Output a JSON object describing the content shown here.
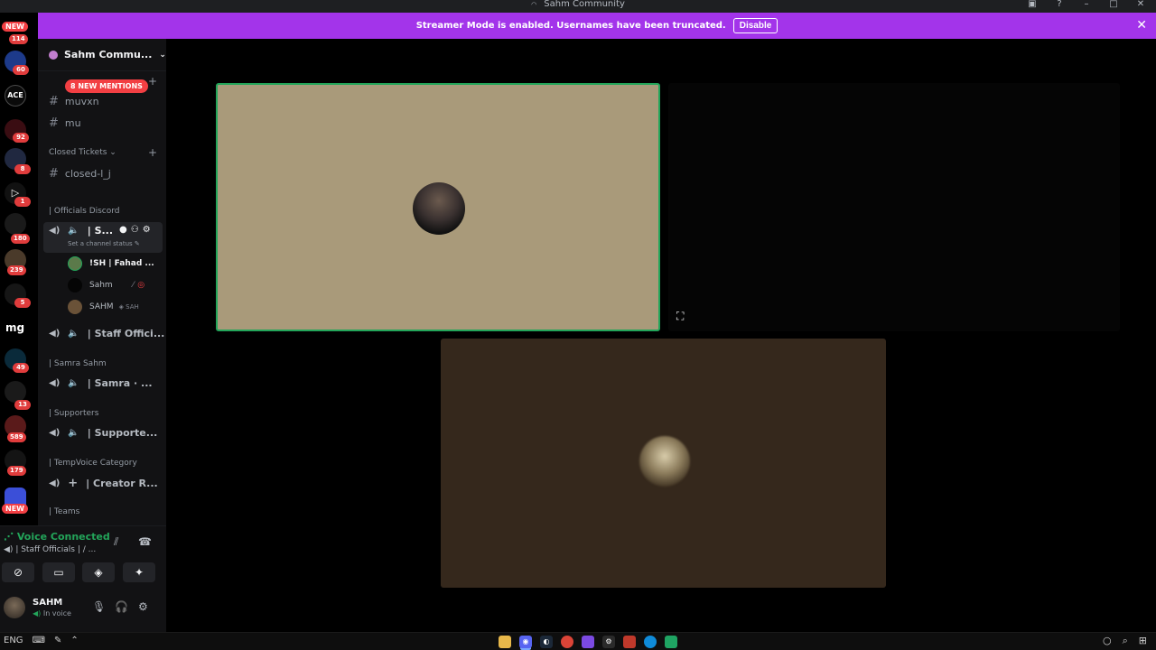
{
  "window": {
    "title": "Sahm Community"
  },
  "banner": {
    "text": "Streamer Mode is enabled. Usernames have been truncated.",
    "button": "Disable"
  },
  "rail": {
    "badges": [
      "114",
      "60",
      "92",
      "8",
      "1",
      "180",
      "239",
      "5",
      "49",
      "13",
      "589",
      "179"
    ],
    "new_label": "NEW",
    "mg_label": "mg",
    "ace_label": "ACE"
  },
  "sidebar": {
    "server_name": "Sahm Commu...",
    "mentions": "8 NEW MENTIONS",
    "channels_top": [
      "muvxn",
      "mu"
    ],
    "closed_category": "Closed Tickets",
    "closed_channel": "closed-l_j",
    "cat_officials": "| Officials Discord",
    "active_voice": "| S...",
    "status_hint": "Set a channel status",
    "members": [
      "!SH | Fahad ...",
      "Sahm",
      "SAHM"
    ],
    "member_tag": "◈ SAH",
    "voice_staff": "| Staff Offici...",
    "cat_samra": "| Samra Sahm",
    "voice_samra": "| Samra · ...",
    "cat_supporters": "| Supporters",
    "voice_supporters": "| Supporte...",
    "cat_temp": "| TempVoice Category",
    "voice_creator": "| Creator R...",
    "cat_teams": "| Teams"
  },
  "voice_panel": {
    "connected": "Voice Connected",
    "channel": "| Staff Officials | / ...",
    "username": "SAHM",
    "status": "In voice"
  },
  "taskbar": {
    "lang": "ENG"
  },
  "colors": {
    "banner": "#a334ea",
    "accent_green": "#23a55a",
    "badge_red": "#f23f43"
  }
}
